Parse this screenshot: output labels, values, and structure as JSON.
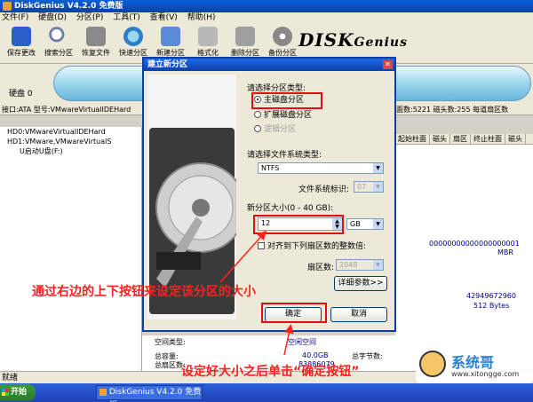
{
  "window": {
    "title": "DiskGenius V4.2.0 免费版"
  },
  "menu": [
    "文件(F)",
    "硬盘(D)",
    "分区(P)",
    "工具(T)",
    "查看(V)",
    "帮助(H)"
  ],
  "toolbar": [
    "保存更改",
    "搜索分区",
    "恢复文件",
    "快速分区",
    "新建分区",
    "格式化",
    "删除分区",
    "备份分区"
  ],
  "logo": {
    "main": "DISK",
    "sub": "Genius"
  },
  "disk": {
    "label": "硬盘 0"
  },
  "info": {
    "left": "接口:ATA  型号:VMwareVirtualIDEHard",
    "right": "柱面数:5221  磁头数:255  每道扇区数"
  },
  "tree": [
    "HD0:VMwareVirtualIDEHard",
    "HD1:VMware,VMwareVirtualS",
    "U启动U盘(F:)"
  ],
  "grid_headers": [
    "起始柱面",
    "磁头",
    "扇区",
    "终止柱面",
    "磁头"
  ],
  "details": {
    "value1": "00000000000000000001",
    "value2": "MBR",
    "value3": "42949672960",
    "value4": "512 Bytes"
  },
  "bottom": {
    "space_type_label": "空间类型:",
    "space_type_value": "空闲空间",
    "total_capacity_label": "总容量:",
    "total_capacity_value": "40.0GB",
    "total_bytes_label": "总字节数:",
    "total_sectors_label": "总扇区数:",
    "total_sectors_value": "83886079"
  },
  "status": "就绪",
  "taskbar": {
    "start": "开始",
    "app": "DiskGenius V4.2.0 免费版"
  },
  "dialog": {
    "title": "建立新分区",
    "type_label": "请选择分区类型:",
    "type_options": [
      {
        "label": "主磁盘分区",
        "selected": true,
        "enabled": true
      },
      {
        "label": "扩展磁盘分区",
        "selected": false,
        "enabled": true
      },
      {
        "label": "逻辑分区",
        "selected": false,
        "enabled": false
      }
    ],
    "fs_label": "请选择文件系统类型:",
    "fs_value": "NTFS",
    "fs_id_label": "文件系统标识:",
    "fs_id_value": "07",
    "size_label": "新分区大小(0 - 40 GB):",
    "size_value": "12",
    "size_unit": "GB",
    "align_label": "对齐到下列扇区数的整数倍:",
    "sector_label": "扇区数:",
    "sector_value": "2048",
    "advanced_button": "详细参数>>",
    "ok_button": "确定",
    "cancel_button": "取消"
  },
  "annotations": {
    "callout1": "通过右边的上下按钮来设定该分区的大小",
    "callout2": "设定好大小之后单击“确定按钮”"
  },
  "watermark": {
    "text": "系统哥",
    "url": "www.xitongge.com"
  },
  "colors": {
    "title_blue": "#0a3fa8",
    "annotation_red": "#ff2020",
    "highlight_red": "#e01010"
  }
}
